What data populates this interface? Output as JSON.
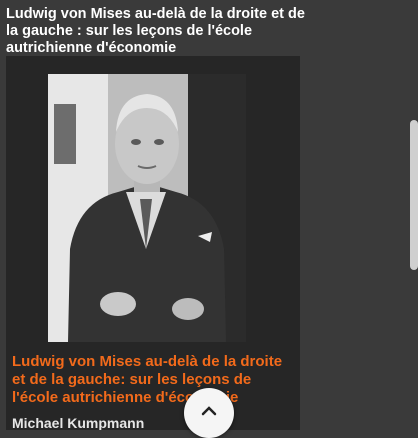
{
  "page": {
    "title": "Ludwig von Mises au-delà de la droite et de la gauche : sur les leçons de l'école autrichienne d'économie"
  },
  "card": {
    "title": "Ludwig von Mises au-delà de la droite et de la gauche: sur les leçons de l'école autrichienne d'économie",
    "author": "Michael Kumpmann",
    "image": "Portrait of Ludwig von Mises"
  },
  "controls": {
    "scroll_top_icon": "chevron-up-icon"
  },
  "colors": {
    "accent": "#f26a1b",
    "background": "#3a3a3a",
    "card": "#262626"
  }
}
